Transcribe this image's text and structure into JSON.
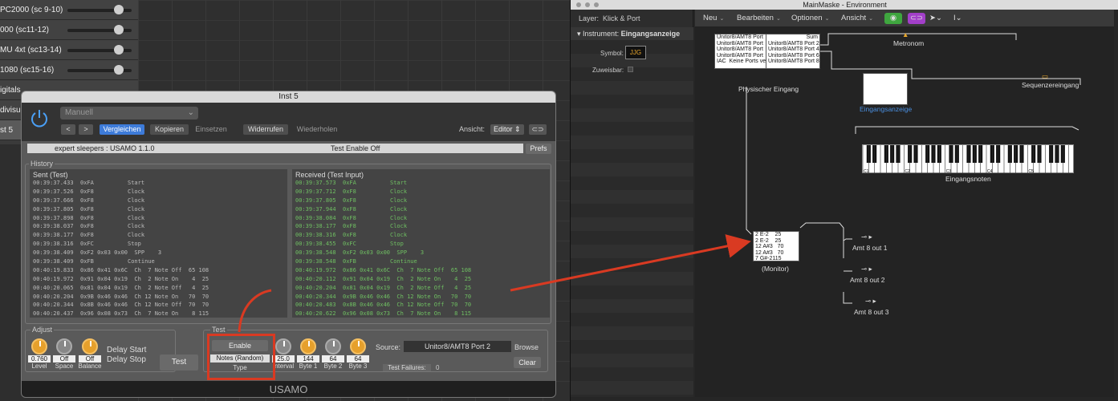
{
  "daw": {
    "tracks": [
      {
        "name": "PC2000 (sc 9-10)",
        "level": 0.85
      },
      {
        "name": "000 (sc11-12)",
        "level": 0.85
      },
      {
        "name": "MU 4xt (sc13-14)",
        "level": 0.85
      },
      {
        "name": "1080 (sc15-16)",
        "level": 0.85
      },
      {
        "name": "igitals"
      },
      {
        "name": "divisua"
      },
      {
        "name": "st 5"
      }
    ]
  },
  "plugin": {
    "window_title": "Inst 5",
    "preset": "Manuell",
    "nav_prev": "<",
    "nav_next": ">",
    "compare": "Vergleichen",
    "copy": "Kopieren",
    "paste": "Einsetzen",
    "undo": "Widerrufen",
    "redo": "Wiederholen",
    "view_label": "Ansicht:",
    "view_value": "Editor",
    "status_left": "expert sleepers : USAMO 1.1.0",
    "status_right": "Test Enable  Off",
    "prefs": "Prefs",
    "history_label": "History",
    "sent_header": "Sent (Test)",
    "received_header": "Received (Test Input)",
    "sent_rows": [
      "00:39:37.433  0xFA          Start",
      "00:39:37.526  0xF8          Clock",
      "00:39:37.666  0xF8          Clock",
      "00:39:37.805  0xF8          Clock",
      "00:39:37.898  0xF8          Clock",
      "00:39:38.037  0xF8          Clock",
      "00:39:38.177  0xF8          Clock",
      "00:39:38.316  0xFC          Stop",
      "00:39:38.409  0xF2 0x03 0x00  SPP    3",
      "00:39:38.409  0xFB          Continue",
      "00:40:19.833  0x86 0x41 0x6C  Ch  7 Note Off  65 108",
      "00:40:19.972  0x91 0x04 0x19  Ch  2 Note On    4  25",
      "00:40:20.065  0x81 0x04 0x19  Ch  2 Note Off   4  25",
      "00:40:20.204  0x9B 0x46 0x46  Ch 12 Note On   70  70",
      "00:40:20.344  0x8B 0x46 0x46  Ch 12 Note Off  70  70",
      "00:40:20.437  0x96 0x08 0x73  Ch  7 Note On    8 115"
    ],
    "received_rows": [
      "00:39:37.573  0xFA          Start",
      "00:39:37.712  0xF8          Clock",
      "00:39:37.805  0xF8          Clock",
      "00:39:37.944  0xF8          Clock",
      "00:39:38.084  0xF8          Clock",
      "00:39:38.177  0xF8          Clock",
      "00:39:38.316  0xF8          Clock",
      "00:39:38.455  0xFC          Stop",
      "00:39:38.548  0xF2 0x03 0x00  SPP    3",
      "00:39:38.548  0xFB          Continue",
      "00:40:19.972  0x86 0x41 0x6C  Ch  7 Note Off  65 108",
      "00:40:20.112  0x91 0x04 0x19  Ch  2 Note On    4  25",
      "00:40:20.204  0x81 0x04 0x19  Ch  2 Note Off   4  25",
      "00:40:20.344  0x9B 0x46 0x46  Ch 12 Note On   70  70",
      "00:40:20.483  0x8B 0x46 0x46  Ch 12 Note Off  70  70",
      "00:40:20.622  0x96 0x08 0x73  Ch  7 Note On    8 115"
    ],
    "adjust_label": "Adjust",
    "knobs_adjust": [
      {
        "value": "0.760",
        "name": "Level",
        "color": "orange"
      },
      {
        "value": "Off",
        "name": "Space",
        "color": "gray"
      },
      {
        "value": "Off",
        "name": "Balance",
        "color": "orange"
      }
    ],
    "delay_start": "Delay Start",
    "delay_stop": "Delay Stop",
    "test_button": "Test",
    "test_label": "Test",
    "enable_button": "Enable",
    "type_value": "Notes (Random)",
    "type_label": "Type",
    "knobs_test": [
      {
        "value": "25.0",
        "name": "Interval",
        "color": "gray"
      },
      {
        "value": "144",
        "name": "Byte 1",
        "color": "orange"
      },
      {
        "value": "64",
        "name": "Byte 2",
        "color": "gray"
      },
      {
        "value": "64",
        "name": "Byte 3",
        "color": "orange"
      }
    ],
    "source_label": "Source:",
    "source_value": "Unitor8/AMT8 Port 2",
    "browse": "Browse",
    "clear": "Clear",
    "test_failures_label": "Test Failures:",
    "test_failures_value": "0",
    "footer": "USAMO"
  },
  "env": {
    "window_title": "MainMaske - Environment",
    "layer_label": "Layer:",
    "layer_value": "Klick & Port",
    "instrument_label": "Instrument:",
    "instrument_value": "Eingangsanzeige",
    "symbol_label": "Symbol:",
    "symbol_value": "JJG",
    "assign_label": "Zuweisbar:",
    "menu": [
      "Neu",
      "Bearbeiten",
      "Optionen",
      "Ansicht"
    ],
    "physical_input_ports": "Unitor8/AMT8 Port\nUnitor8/AMT8 Port\nUnitor8/AMT8 Port\nUnitor8/AMT8 Port\nIAC  Keine Ports ve",
    "physical_input_outs": "Sum\nUnitor8/AMT8 Port 2\nUnitor8/AMT8 Port 4\nUnitor8/AMT8 Port 6\nUnitor8/AMT8 Port 8",
    "physical_input_label": "Physischer Eingang",
    "metronome_label": "Metronom",
    "sequencer_input_label": "Sequenzereingang",
    "display_label": "Eingangsanzeige",
    "piano_keys": [
      "C1",
      "C2",
      "C3",
      "C4",
      "C5"
    ],
    "piano_label": "Eingangsnoten",
    "monitor_lines": "2 E-2    25\n2 E-2    25\n12 A#3   70\n12 A#3   70\n7 G#-2115",
    "monitor_label": "(Monitor)",
    "outs": [
      "Amt 8 out 1",
      "Amt 8  out 2",
      "Amt 8 out 3"
    ],
    "colors": {
      "highlight": "#d93a22",
      "accent": "#3d7bd9",
      "green_log": "#6fbf62",
      "knob": "#e6a02c"
    }
  }
}
